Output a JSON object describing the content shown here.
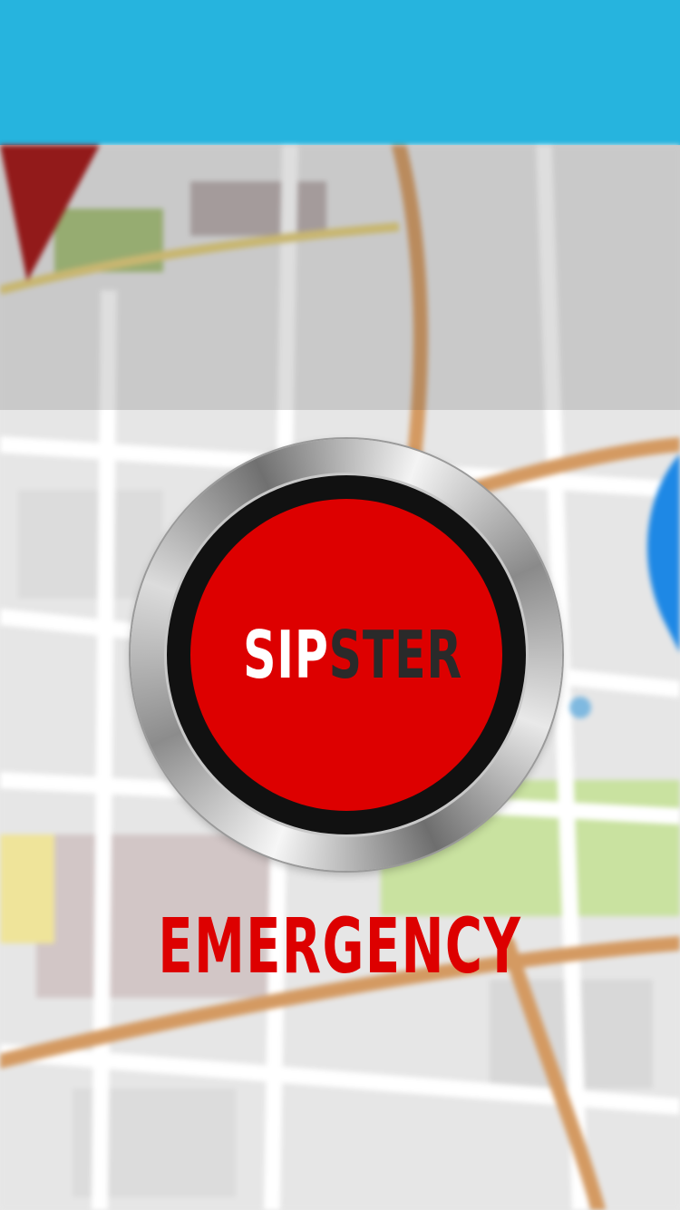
{
  "header": {
    "color": "#26b4de"
  },
  "background": {
    "description_icon": "map-background"
  },
  "sos_button": {
    "logo_part1": "SIP",
    "logo_part2": "STER",
    "face_color": "#dd0000"
  },
  "emergency_label": "EMERGENCY"
}
